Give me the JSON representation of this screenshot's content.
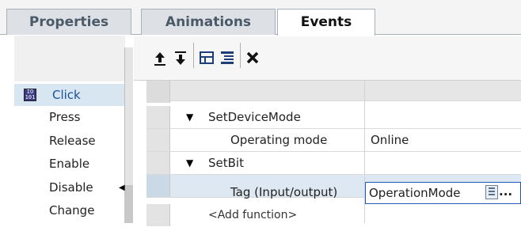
{
  "tabs": {
    "properties": "Properties",
    "animations": "Animations",
    "events": "Events"
  },
  "events_list": [
    "Click",
    "Press",
    "Release",
    "Enable",
    "Disable",
    "Change"
  ],
  "toolbar": {
    "move_up_icon": "move-up-icon",
    "move_down_icon": "move-down-icon",
    "expand_all_icon": "expand-all-icon",
    "collapse_all_icon": "collapse-all-icon",
    "delete_icon": "delete-icon"
  },
  "grid": {
    "rows": [
      {
        "label": "SetDeviceMode",
        "value": ""
      },
      {
        "label": "Operating mode",
        "value": "Online"
      },
      {
        "label": "SetBit",
        "value": ""
      },
      {
        "label": "Tag (Input/output)",
        "value": "OperationMode"
      },
      {
        "label": "<Add function>",
        "value": ""
      }
    ],
    "ellipsis": "..."
  },
  "colors": {
    "selection": "#d8e6f1",
    "focus_border": "#1f5bb3"
  }
}
